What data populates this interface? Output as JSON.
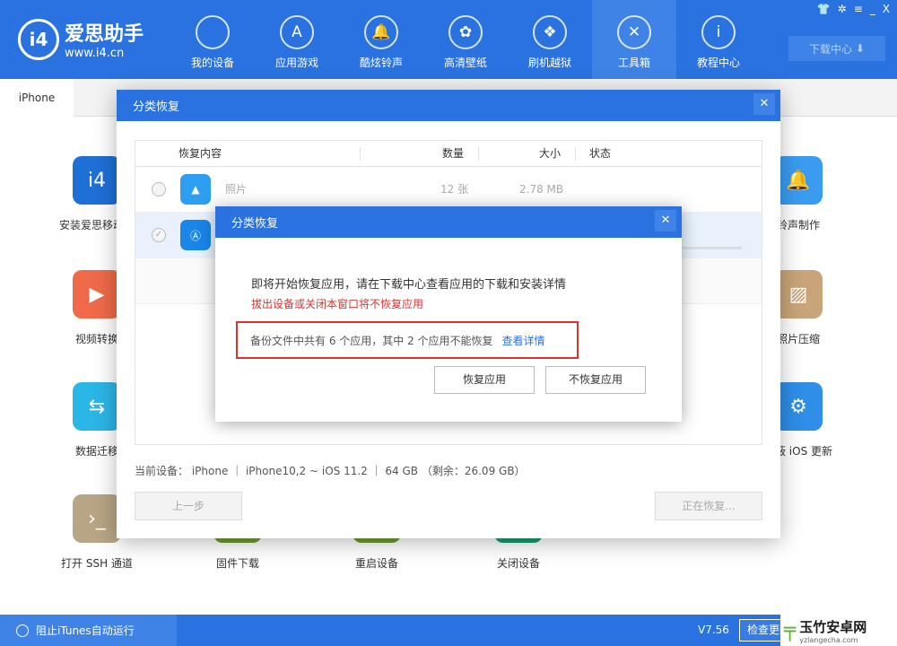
{
  "app": {
    "logo_name": "爱思助手",
    "logo_url": "www.i4.cn",
    "logo_mark": "i4"
  },
  "nav": [
    {
      "label": "我的设备",
      "icon": "apple-icon"
    },
    {
      "label": "应用游戏",
      "icon": "app-store-icon"
    },
    {
      "label": "酷炫铃声",
      "icon": "bell-icon"
    },
    {
      "label": "高清壁纸",
      "icon": "flower-icon"
    },
    {
      "label": "刷机越狱",
      "icon": "dropbox-icon"
    },
    {
      "label": "工具箱",
      "icon": "tools-icon",
      "active": true
    },
    {
      "label": "教程中心",
      "icon": "info-icon"
    }
  ],
  "download_center": "下载中心",
  "tab": "iPhone",
  "tiles_left": [
    "安装爱思移动端",
    "视频转换",
    "数据迁移",
    "打开 SSH 通道"
  ],
  "tiles_right": [
    "铃声制作",
    "照片压缩",
    "屏蔽 iOS 更新"
  ],
  "tiles_bottom": [
    "固件下载",
    "重启设备",
    "关闭设备"
  ],
  "dialog": {
    "title": "分类恢复",
    "columns": [
      "恢复内容",
      "数量",
      "大小",
      "状态"
    ],
    "rows": [
      {
        "name": "照片",
        "count": "12 张",
        "size": "2.78 MB"
      },
      {
        "name": "应用",
        "count": "",
        "size": ""
      }
    ],
    "device_info": "当前设备： iPhone  ｜  iPhone10,2 ~ iOS 11.2  ｜  64 GB （剩余：26.09 GB）",
    "prev": "上一步",
    "restoring": "正在恢复..."
  },
  "inner": {
    "title": "分类恢复",
    "msg": "即将开始恢复应用，请在下载中心查看应用的下载和安装详情",
    "warn": "拔出设备或关闭本窗口将不恢复应用",
    "note": "备份文件中共有 6 个应用，其中 2 个应用不能恢复",
    "link": "查看详情",
    "ok": "恢复应用",
    "cancel": "不恢复应用"
  },
  "status": {
    "itunes": "阻止iTunes自动运行",
    "version": "V7.56",
    "check": "检查更新"
  },
  "watermark": {
    "name": "玉竹安卓网",
    "url": "yzlangecha.com"
  },
  "colors": {
    "brand": "#2a72e0",
    "warn": "#e0312d"
  }
}
